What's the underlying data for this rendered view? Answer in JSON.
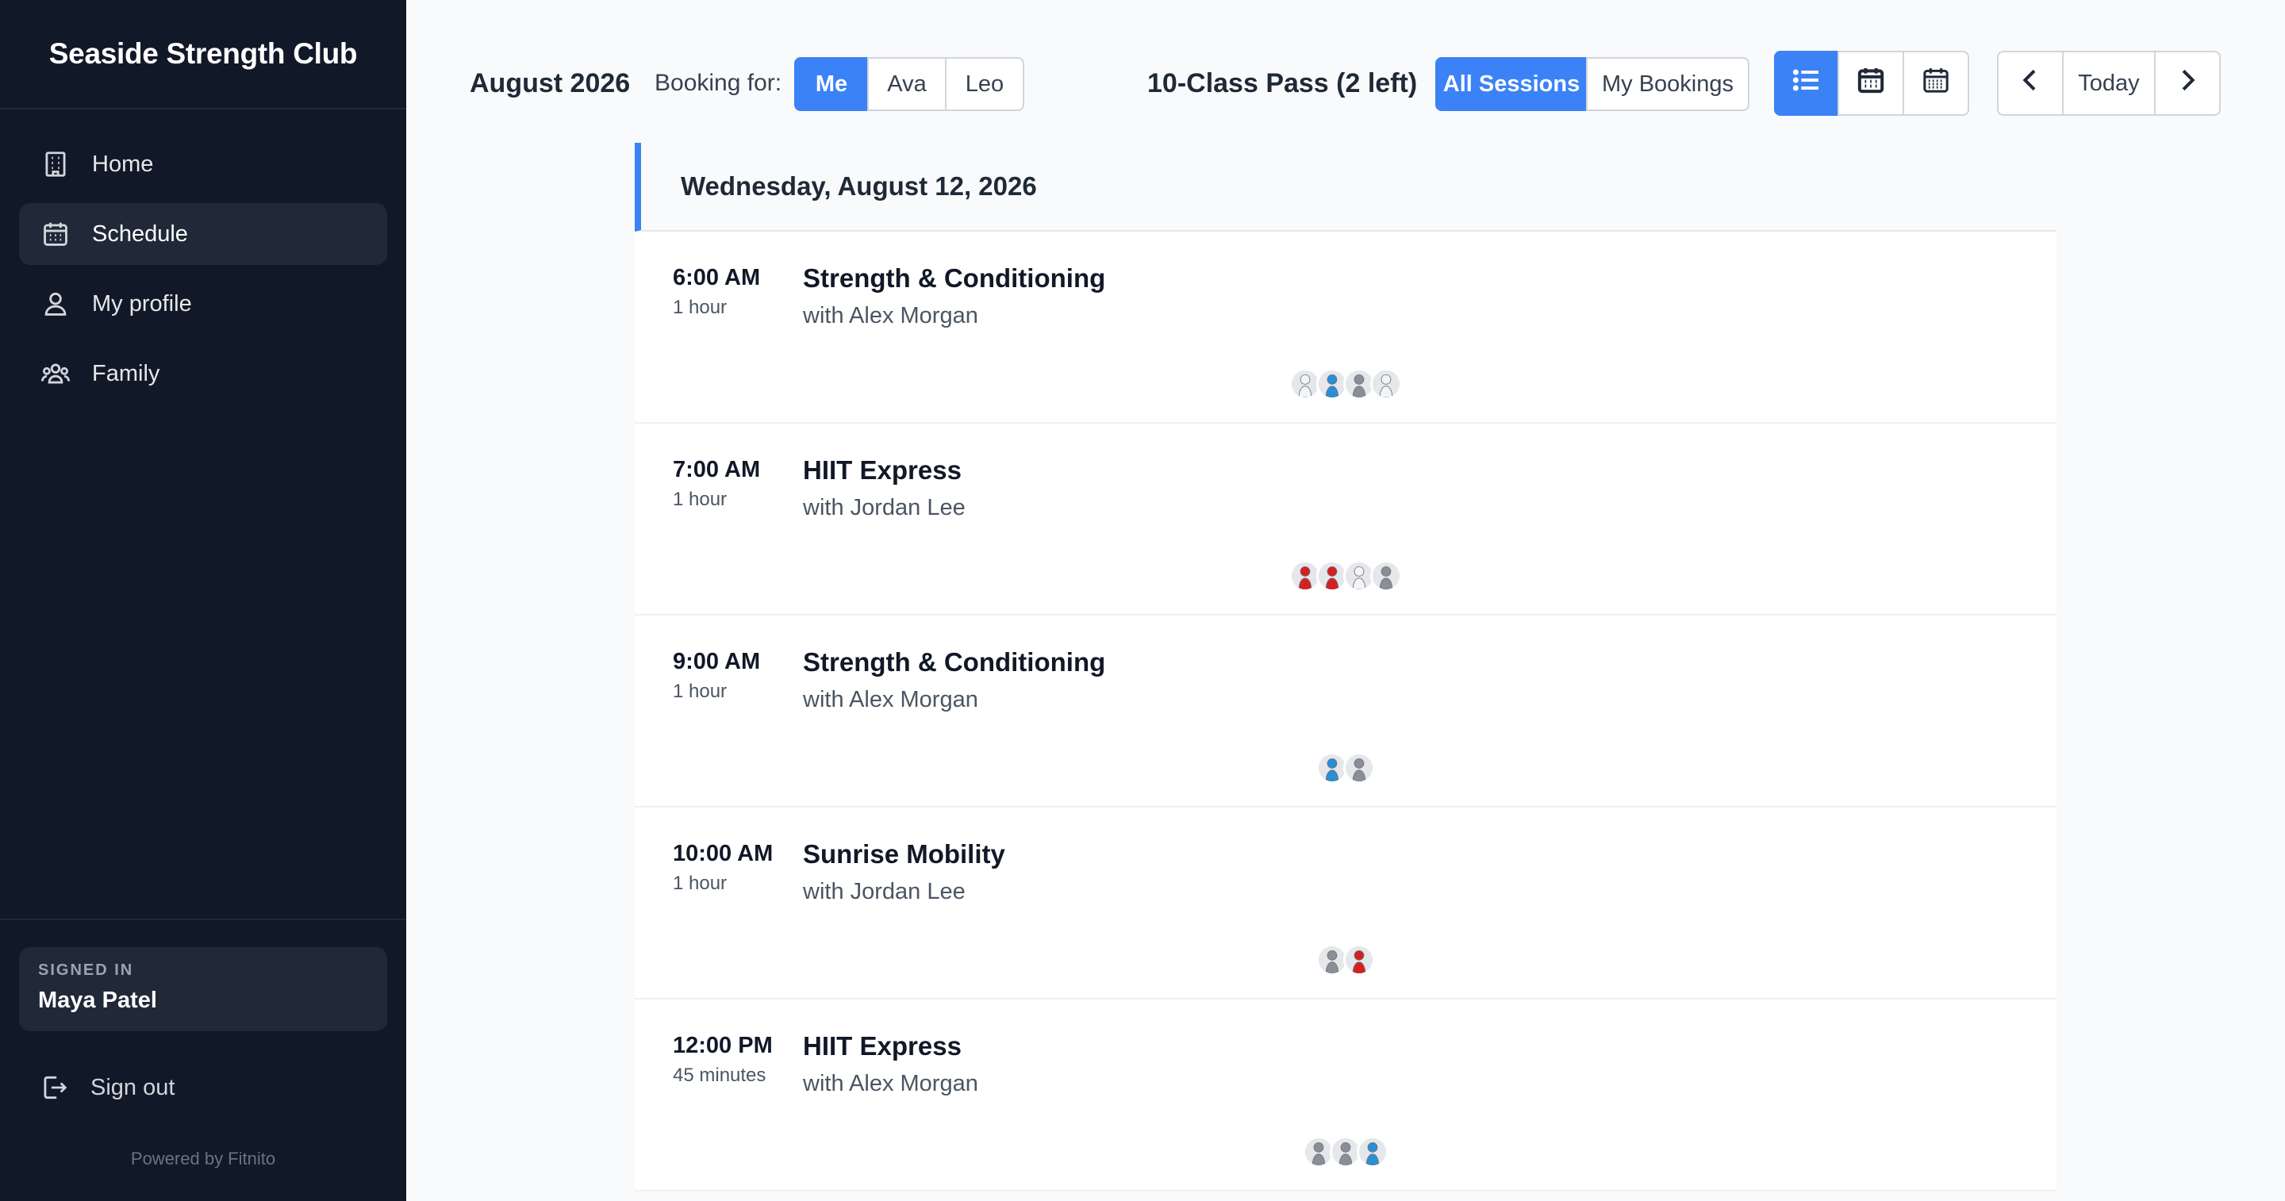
{
  "sidebar": {
    "brand": "Seaside Strength Club",
    "nav": [
      {
        "label": "Home",
        "icon": "building-icon",
        "active": false
      },
      {
        "label": "Schedule",
        "icon": "calendar-icon",
        "active": true
      },
      {
        "label": "My profile",
        "icon": "user-icon",
        "active": false
      },
      {
        "label": "Family",
        "icon": "users-icon",
        "active": false
      }
    ],
    "signed_in_label": "SIGNED IN",
    "user_name": "Maya Patel",
    "sign_out": "Sign out",
    "powered_by": "Powered by Fitnito"
  },
  "toolbar": {
    "month": "August 2026",
    "booking_for_label": "Booking for:",
    "booking_options": [
      {
        "label": "Me",
        "active": true
      },
      {
        "label": "Ava",
        "active": false
      },
      {
        "label": "Leo",
        "active": false
      }
    ],
    "pass": "10-Class Pass (2 left)",
    "filters": [
      {
        "label": "All Sessions",
        "active": true
      },
      {
        "label": "My Bookings",
        "active": false
      }
    ],
    "views": [
      {
        "icon": "list-view-icon",
        "active": true
      },
      {
        "icon": "week-calendar-icon",
        "active": false
      },
      {
        "icon": "month-calendar-icon",
        "active": false
      }
    ],
    "nav": {
      "prev_icon": "chevron-left-icon",
      "today": "Today",
      "next_icon": "chevron-right-icon"
    }
  },
  "day": {
    "header": "Wednesday, August 12, 2026",
    "sessions": [
      {
        "time": "6:00 AM",
        "duration": "1 hour",
        "title": "Strength & Conditioning",
        "coach": "with Alex Morgan",
        "attendees": [
          "white",
          "blue",
          "gray",
          "white"
        ]
      },
      {
        "time": "7:00 AM",
        "duration": "1 hour",
        "title": "HIIT Express",
        "coach": "with Jordan Lee",
        "attendees": [
          "red",
          "red",
          "white",
          "gray"
        ]
      },
      {
        "time": "9:00 AM",
        "duration": "1 hour",
        "title": "Strength & Conditioning",
        "coach": "with Alex Morgan",
        "attendees": [
          "blue",
          "gray"
        ]
      },
      {
        "time": "10:00 AM",
        "duration": "1 hour",
        "title": "Sunrise Mobility",
        "coach": "with Jordan Lee",
        "attendees": [
          "gray",
          "red"
        ]
      },
      {
        "time": "12:00 PM",
        "duration": "45 minutes",
        "title": "HIIT Express",
        "coach": "with Alex Morgan",
        "attendees": [
          "gray",
          "gray",
          "blue"
        ]
      }
    ]
  },
  "colors": {
    "sidebar_bg": "#111827",
    "accent": "#3b82f6",
    "avatar_colors": {
      "white": "#f3f4f6",
      "blue": "#2b8fd1",
      "gray": "#8a8f96",
      "red": "#d62020"
    }
  }
}
